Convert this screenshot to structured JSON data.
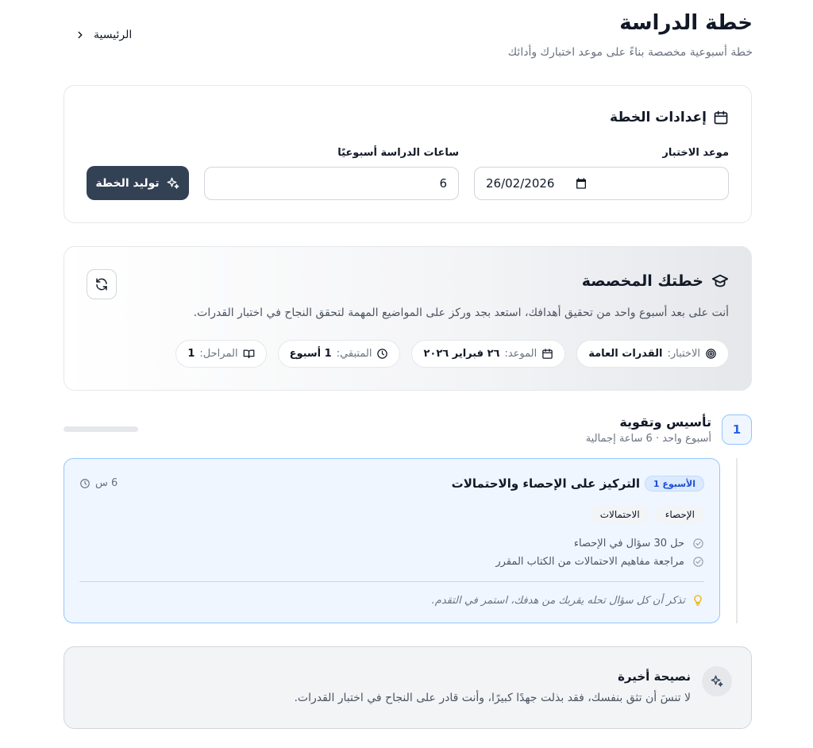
{
  "header": {
    "title": "خطة الدراسة",
    "subtitle": "خطة أسبوعية مخصصة بناءً على موعد اختبارك وأدائك",
    "home_link": "الرئيسية"
  },
  "settings": {
    "title": "إعدادات الخطة",
    "exam_date_label": "موعد الاختبار",
    "exam_date_value": "26/02/2026",
    "weekly_hours_label": "ساعات الدراسة أسبوعيًا",
    "weekly_hours_value": "6",
    "generate_button": "توليد الخطة"
  },
  "plan": {
    "title": "خطتك المخصصة",
    "description": "أنت على بعد أسبوع واحد من تحقيق أهدافك، استعد بجد وركز على المواضيع المهمة لتحقق النجاح في اختبار القدرات.",
    "chips": [
      {
        "key": "الاختبار:",
        "value": "القدرات العامة",
        "icon": "target-icon"
      },
      {
        "key": "الموعد:",
        "value": "٢٦ فبراير ٢٠٢٦",
        "icon": "calendar-icon"
      },
      {
        "key": "المتبقي:",
        "value": "1 أسبوع",
        "icon": "clock-icon"
      },
      {
        "key": "المراحل:",
        "value": "1",
        "icon": "book-icon"
      }
    ]
  },
  "phase": {
    "number": "1",
    "title": "تأسيس وتقوية",
    "subtitle": "أسبوع واحد · 6 ساعة إجمالية",
    "progress": 0
  },
  "week": {
    "badge": "الأسبوع 1",
    "title": "التركيز على الإحصاء والاحتمالات",
    "hours": "6 س",
    "tags": [
      "الإحصاء",
      "الاحتمالات"
    ],
    "tasks": [
      "حل 30 سؤال في الإحصاء",
      "مراجعة مفاهيم الاحتمالات من الكتاب المقرر"
    ],
    "tip": "تذكر أن كل سؤال تحله يقربك من هدفك، استمر في التقدم."
  },
  "final_tip": {
    "title": "نصيحة أخيرة",
    "text": "لا تنسَ أن تثق بنفسك، فقد بذلت جهدًا كبيرًا، وأنت قادر على النجاح في اختبار القدرات."
  },
  "colors": {
    "primary_button": "#334155",
    "accent_blue": "#3b82f6",
    "week_bg": "#f0f6ff"
  }
}
